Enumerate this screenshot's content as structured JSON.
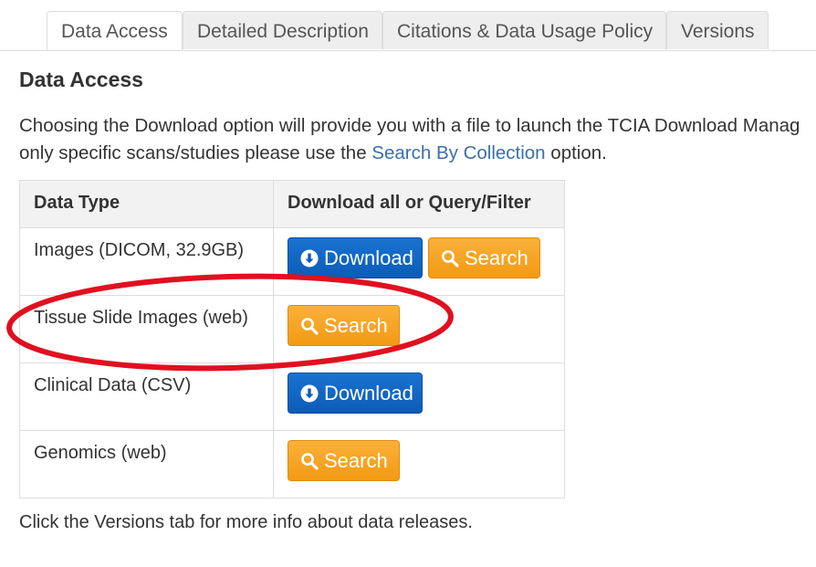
{
  "tabs": [
    {
      "label": "Data Access",
      "active": true
    },
    {
      "label": "Detailed Description",
      "active": false
    },
    {
      "label": "Citations & Data Usage Policy",
      "active": false
    },
    {
      "label": "Versions",
      "active": false
    }
  ],
  "section": {
    "title": "Data Access"
  },
  "intro": {
    "line1": "Choosing the Download option will provide you with a file to launch the TCIA Download Manag",
    "line2_before": "only specific scans/studies please use the ",
    "link": "Search By Collection",
    "line2_after": " option."
  },
  "table": {
    "headers": [
      "Data Type",
      "Download all or Query/Filter"
    ],
    "rows": [
      {
        "type": "Images (DICOM, 32.9GB)",
        "buttons": [
          "Download",
          "Search"
        ]
      },
      {
        "type": "Tissue Slide Images (web)",
        "buttons": [
          "Search"
        ]
      },
      {
        "type": "Clinical Data (CSV)",
        "buttons": [
          "Download"
        ]
      },
      {
        "type": "Genomics (web)",
        "buttons": [
          "Search"
        ]
      }
    ]
  },
  "buttons": {
    "download_label": "Download",
    "search_label": "Search",
    "download_icon": "arrow-down-circle-icon",
    "search_icon": "magnifier-icon"
  },
  "footer": {
    "note": "Click the Versions tab for more info about data releases."
  },
  "colors": {
    "download": "#0c5cb8",
    "search": "#f39a12",
    "link": "#3a6fa8",
    "annotation": "#e01020"
  }
}
